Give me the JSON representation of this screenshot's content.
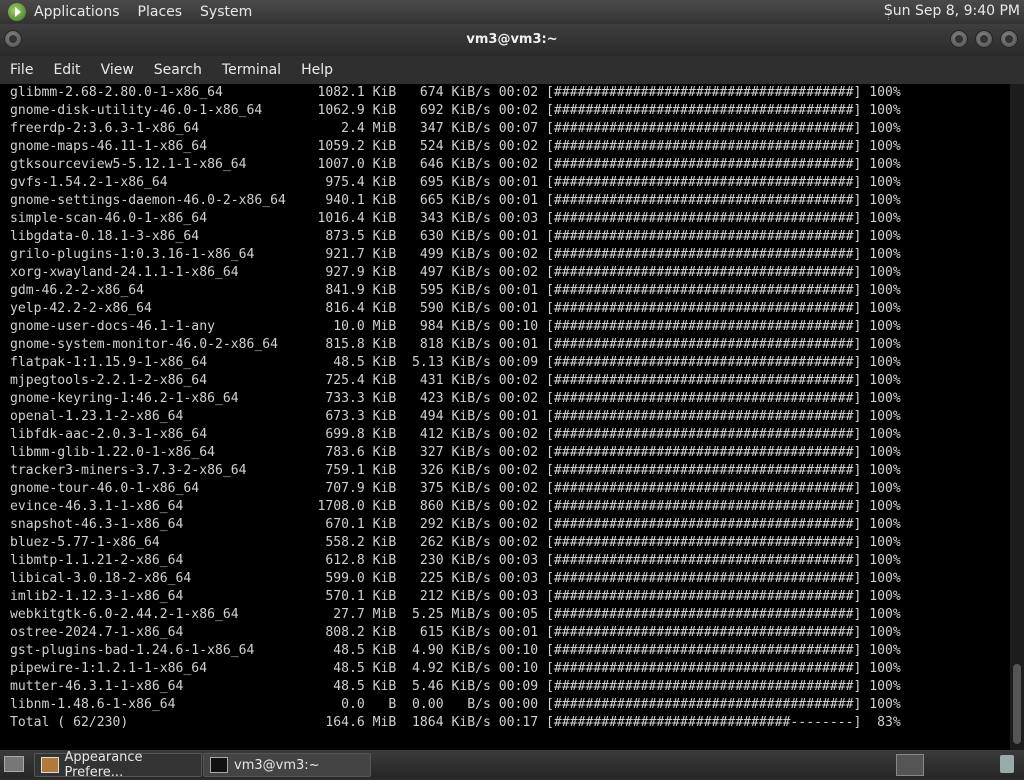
{
  "top_panel": {
    "menus": [
      "Applications",
      "Places",
      "System"
    ],
    "clock": "Sun Sep  8, 9:40 PM"
  },
  "window": {
    "title": "vm3@vm3:~"
  },
  "menubar": [
    "File",
    "Edit",
    "View",
    "Search",
    "Terminal",
    "Help"
  ],
  "terminal": {
    "lines": [
      "glibmm-2.68-2.80.0-1-x86_64            1082.1 KiB   674 KiB/s 00:02 [######################################] 100%",
      "gnome-disk-utility-46.0-1-x86_64       1062.9 KiB   692 KiB/s 00:02 [######################################] 100%",
      "freerdp-2:3.6.3-1-x86_64                  2.4 MiB   347 KiB/s 00:07 [######################################] 100%",
      "gnome-maps-46.11-1-x86_64              1059.2 KiB   524 KiB/s 00:02 [######################################] 100%",
      "gtksourceview5-5.12.1-1-x86_64         1007.0 KiB   646 KiB/s 00:02 [######################################] 100%",
      "gvfs-1.54.2-1-x86_64                    975.4 KiB   695 KiB/s 00:01 [######################################] 100%",
      "gnome-settings-daemon-46.0-2-x86_64     940.1 KiB   665 KiB/s 00:01 [######################################] 100%",
      "simple-scan-46.0-1-x86_64              1016.4 KiB   343 KiB/s 00:03 [######################################] 100%",
      "libgdata-0.18.1-3-x86_64                873.5 KiB   630 KiB/s 00:01 [######################################] 100%",
      "grilo-plugins-1:0.3.16-1-x86_64         921.7 KiB   499 KiB/s 00:02 [######################################] 100%",
      "xorg-xwayland-24.1.1-1-x86_64           927.9 KiB   497 KiB/s 00:02 [######################################] 100%",
      "gdm-46.2-2-x86_64                       841.9 KiB   595 KiB/s 00:01 [######################################] 100%",
      "yelp-42.2-2-x86_64                      816.4 KiB   590 KiB/s 00:01 [######################################] 100%",
      "gnome-user-docs-46.1-1-any               10.0 MiB   984 KiB/s 00:10 [######################################] 100%",
      "gnome-system-monitor-46.0-2-x86_64      815.8 KiB   818 KiB/s 00:01 [######################################] 100%",
      "flatpak-1:1.15.9-1-x86_64                48.5 KiB  5.13 KiB/s 00:09 [######################################] 100%",
      "mjpegtools-2.2.1-2-x86_64               725.4 KiB   431 KiB/s 00:02 [######################################] 100%",
      "gnome-keyring-1:46.2-1-x86_64           733.3 KiB   423 KiB/s 00:02 [######################################] 100%",
      "openal-1.23.1-2-x86_64                  673.3 KiB   494 KiB/s 00:01 [######################################] 100%",
      "libfdk-aac-2.0.3-1-x86_64               699.8 KiB   412 KiB/s 00:02 [######################################] 100%",
      "libmm-glib-1.22.0-1-x86_64              783.6 KiB   327 KiB/s 00:02 [######################################] 100%",
      "tracker3-miners-3.7.3-2-x86_64          759.1 KiB   326 KiB/s 00:02 [######################################] 100%",
      "gnome-tour-46.0-1-x86_64                707.9 KiB   375 KiB/s 00:02 [######################################] 100%",
      "evince-46.3.1-1-x86_64                 1708.0 KiB   860 KiB/s 00:02 [######################################] 100%",
      "snapshot-46.3-1-x86_64                  670.1 KiB   292 KiB/s 00:02 [######################################] 100%",
      "bluez-5.77-1-x86_64                     558.2 KiB   262 KiB/s 00:02 [######################################] 100%",
      "libmtp-1.1.21-2-x86_64                  612.8 KiB   230 KiB/s 00:03 [######################################] 100%",
      "libical-3.0.18-2-x86_64                 599.0 KiB   225 KiB/s 00:03 [######################################] 100%",
      "imlib2-1.12.3-1-x86_64                  570.1 KiB   212 KiB/s 00:03 [######################################] 100%",
      "webkitgtk-6.0-2.44.2-1-x86_64            27.7 MiB  5.25 MiB/s 00:05 [######################################] 100%",
      "ostree-2024.7-1-x86_64                  808.2 KiB   615 KiB/s 00:01 [######################################] 100%",
      "gst-plugins-bad-1.24.6-1-x86_64          48.5 KiB  4.90 KiB/s 00:10 [######################################] 100%",
      "pipewire-1:1.2.1-1-x86_64                48.5 KiB  4.92 KiB/s 00:10 [######################################] 100%",
      "mutter-46.3.1-1-x86_64                   48.5 KiB  5.46 KiB/s 00:09 [######################################] 100%",
      "libnm-1.48.6-1-x86_64                     0.0   B  0.00   B/s 00:00 [######################################] 100%",
      "Total ( 62/230)                         164.6 MiB  1864 KiB/s 00:17 [##############################--------]  83%"
    ]
  },
  "taskbar": {
    "tasks": [
      {
        "label": "Appearance Prefere..."
      },
      {
        "label": "vm3@vm3:~"
      }
    ]
  }
}
